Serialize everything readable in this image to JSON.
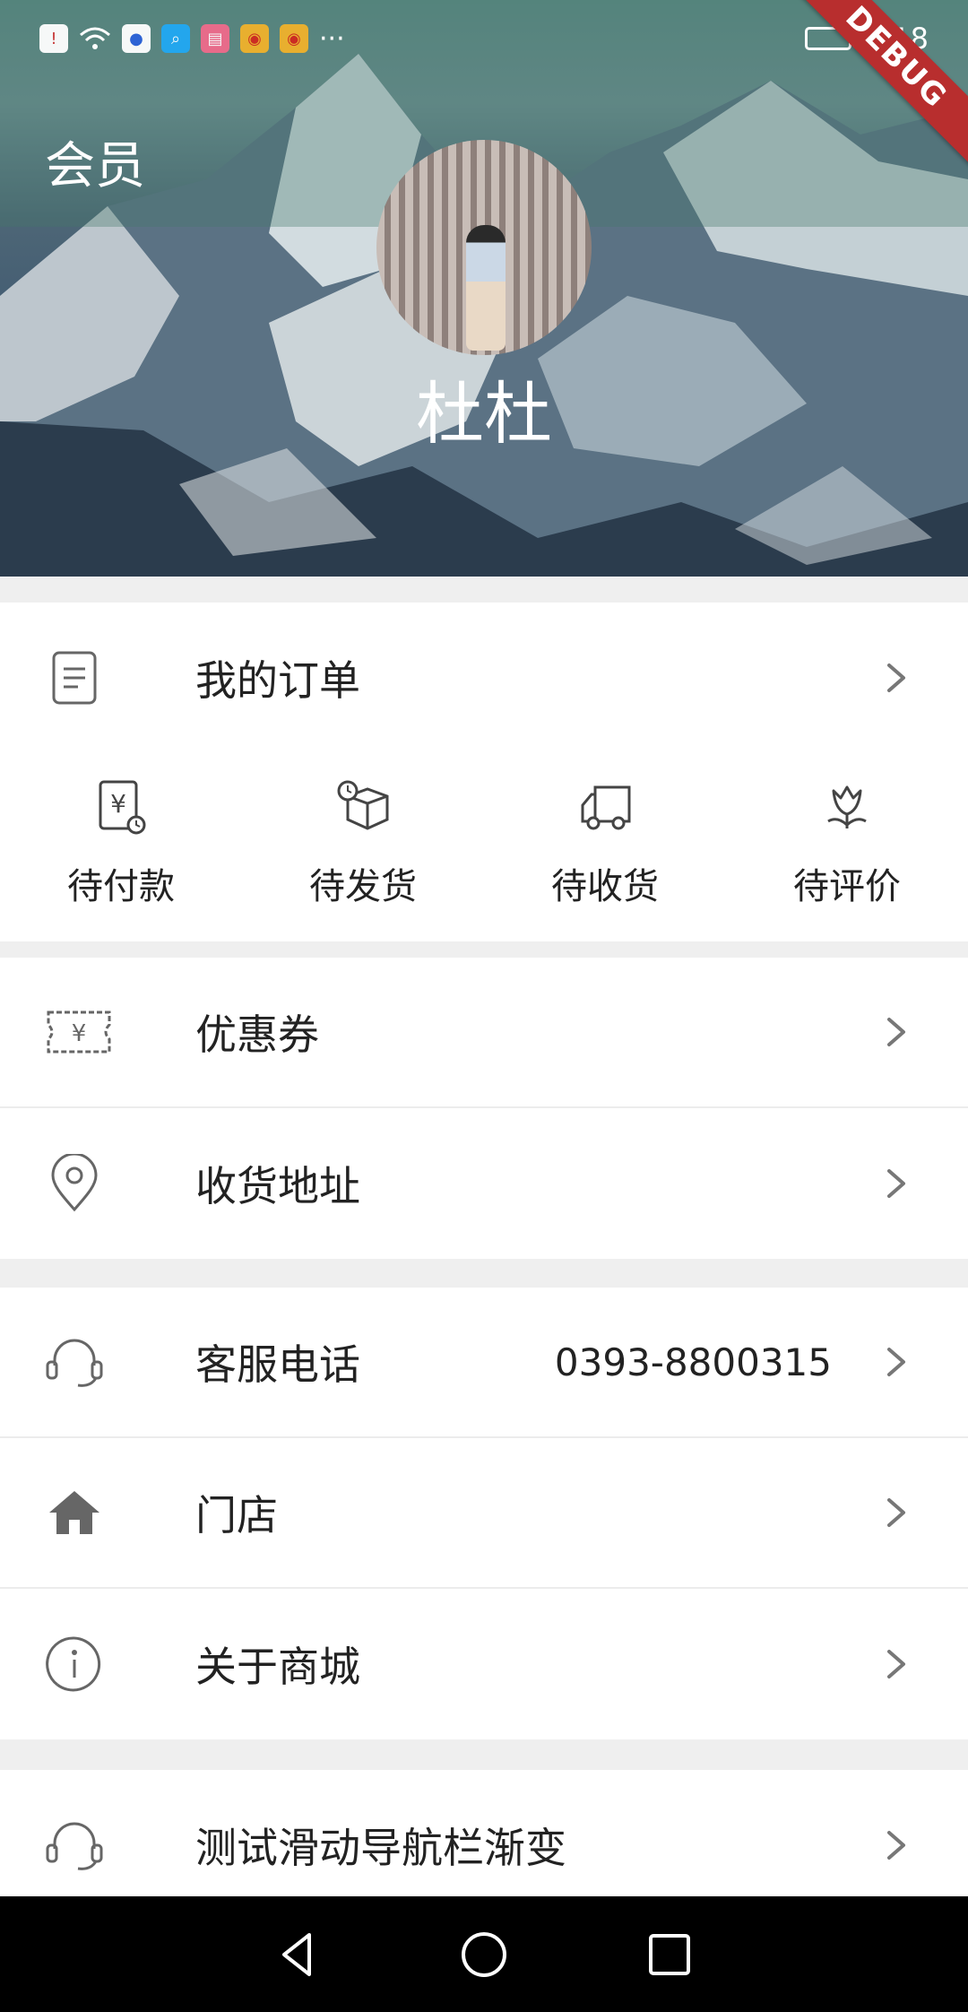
{
  "status_bar": {
    "time": "2:18",
    "notification_icons": [
      "alert-icon",
      "wifi-icon",
      "baidu-icon",
      "search-app-icon",
      "book-app-icon",
      "weibo-icon",
      "weibo-icon"
    ],
    "more": "···"
  },
  "debug_banner": "DEBUG",
  "header": {
    "title": "会员",
    "user_name": "杜杜"
  },
  "orders": {
    "title": "我的订单",
    "items": [
      {
        "label": "待付款",
        "icon": "pending-payment-icon"
      },
      {
        "label": "待发货",
        "icon": "pending-shipment-icon"
      },
      {
        "label": "待收货",
        "icon": "pending-receipt-icon"
      },
      {
        "label": "待评价",
        "icon": "pending-review-icon"
      }
    ]
  },
  "menu": {
    "coupons": "优惠券",
    "address": "收货地址",
    "service_phone": "客服电话",
    "service_phone_number": "0393-8800315",
    "store": "门店",
    "about": "关于商城",
    "test_nav": "测试滑动导航栏渐变"
  },
  "colors": {
    "accent_debug": "#b82e2e",
    "icon_gray": "#666666",
    "background": "#efefef"
  }
}
